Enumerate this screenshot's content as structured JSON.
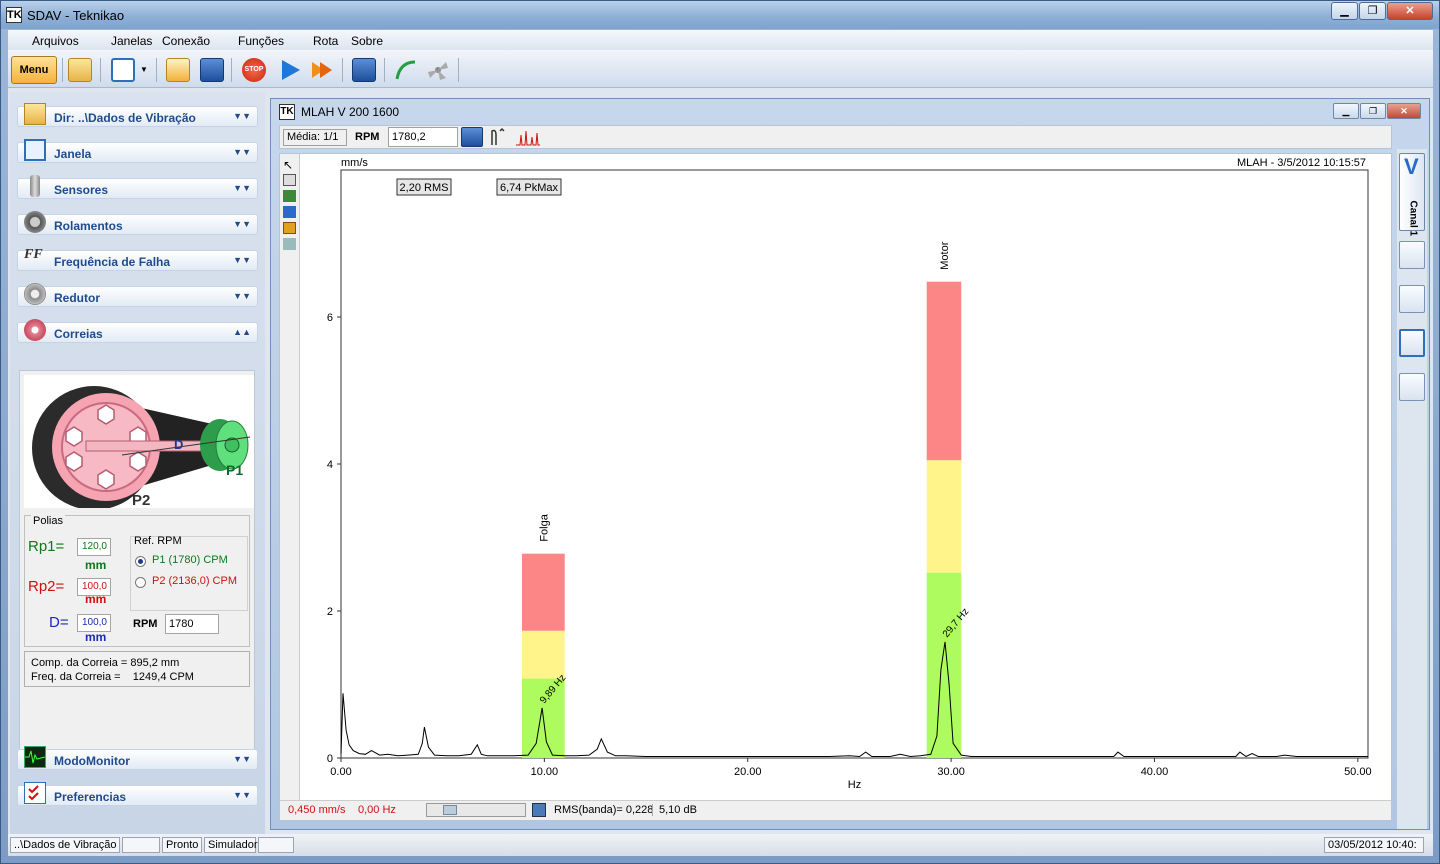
{
  "window": {
    "title": "SDAV - Teknikao",
    "app_icon": "TK"
  },
  "menu": [
    "Arquivos",
    "Janelas",
    "Conexão",
    "Funções",
    "Rota",
    "Sobre"
  ],
  "toolbar": {
    "menu_label": "Menu",
    "stop_label": "STOP"
  },
  "sidebar": {
    "items": [
      "Dir: ..\\Dados de Vibração",
      "Janela",
      "Sensores",
      "Rolamentos",
      "Frequência de Falha",
      "Redutor",
      "Correias"
    ],
    "bottom_items": [
      "ModoMonitor",
      "Preferencias"
    ]
  },
  "belt": {
    "image_labels": {
      "d": "D",
      "p1": "P1",
      "p2": "P2"
    },
    "polias_title": "Polias",
    "rp1_label": "Rp1=",
    "rp1_value": "120,0",
    "rp1_unit": "mm",
    "rp2_label": "Rp2=",
    "rp2_value": "100,0",
    "rp2_unit": "mm",
    "d_label": "D=",
    "d_value": "100,0",
    "d_unit": "mm",
    "ref_title": "Ref. RPM",
    "ref_p1": "P1 (1780) CPM",
    "ref_p2": "P2 (2136,0) CPM",
    "rpm_label": "RPM",
    "rpm_value": "1780",
    "comp": "Comp. da Correia = 895,2 mm",
    "freq": "Freq. da Correia =    1249,4 CPM"
  },
  "statusbar": {
    "path": "..\\Dados de Vibração",
    "state": "Pronto",
    "mode": "Simulador",
    "datetime": "03/05/2012 10:40:"
  },
  "child": {
    "title": "MLAH V 200 1600",
    "media": "Média: 1/1",
    "rpm_label": "RPM",
    "rpm_value": "1780,2"
  },
  "plot_status": {
    "amp": "0,450 mm/s",
    "freq": "0,00 Hz",
    "rms_band": "RMS(banda)= 0,228",
    "db": "5,10 dB"
  },
  "right_tab": "Canal 1",
  "chart_data": {
    "type": "line",
    "unit_label": "mm/s",
    "header_right": "MLAH - 3/5/2012 10:15:57",
    "xlabel": "Hz",
    "xlim": [
      0,
      50.5
    ],
    "ylim": [
      0,
      8
    ],
    "xticks": [
      "0.00",
      "10.00",
      "20.00",
      "30.00",
      "40.00",
      "50.00"
    ],
    "yticks": [
      "0",
      "2",
      "4",
      "6"
    ],
    "overall": {
      "rms": "2,20 RMS",
      "pkmax": "6,74 PkMax"
    },
    "alarm_bands": [
      {
        "name": "Folga",
        "x0": 8.9,
        "x1": 11.0,
        "green": 1.08,
        "yellow": 1.73,
        "red": 2.78
      },
      {
        "name": "Motor",
        "x0": 28.8,
        "x1": 30.5,
        "green": 2.52,
        "yellow": 4.05,
        "red": 6.48
      }
    ],
    "peak_labels": [
      {
        "text": "9,89 Hz",
        "x": 9.89,
        "y": 0.68
      },
      {
        "text": "29,7 Hz",
        "x": 29.7,
        "y": 1.58
      }
    ],
    "colors": {
      "green": "#adfb5e",
      "yellow": "#fef48a",
      "red": "#fc8585"
    },
    "spectrum": {
      "x": [
        0,
        0.1,
        0.25,
        0.4,
        0.6,
        0.9,
        1.2,
        1.5,
        1.9,
        2.3,
        2.8,
        3.3,
        3.8,
        4.0,
        4.1,
        4.3,
        4.6,
        5.2,
        5.8,
        6.4,
        6.7,
        6.9,
        7.2,
        7.8,
        8.5,
        9.2,
        9.6,
        9.89,
        10.1,
        10.4,
        11.0,
        11.6,
        12.2,
        12.6,
        12.8,
        13.1,
        13.5,
        14.0,
        15,
        16,
        17,
        18,
        19,
        20,
        21,
        22,
        23,
        24,
        25,
        25.5,
        25.8,
        26.1,
        27,
        27.5,
        28,
        28.5,
        29,
        29.3,
        29.5,
        29.7,
        29.9,
        30.1,
        30.5,
        31,
        32,
        33,
        34,
        35,
        36,
        37,
        38,
        38.2,
        38.5,
        39,
        40,
        41,
        42,
        43,
        44,
        44.2,
        44.5,
        44.8,
        45.1,
        45.5,
        46,
        46.4,
        47,
        48,
        49,
        50,
        50.5
      ],
      "y": [
        0.05,
        0.88,
        0.38,
        0.18,
        0.1,
        0.06,
        0.05,
        0.1,
        0.04,
        0.05,
        0.03,
        0.04,
        0.05,
        0.2,
        0.42,
        0.15,
        0.04,
        0.03,
        0.03,
        0.05,
        0.18,
        0.05,
        0.03,
        0.03,
        0.03,
        0.04,
        0.2,
        0.68,
        0.22,
        0.04,
        0.03,
        0.03,
        0.04,
        0.12,
        0.26,
        0.08,
        0.03,
        0.03,
        0.02,
        0.02,
        0.02,
        0.02,
        0.02,
        0.02,
        0.02,
        0.02,
        0.02,
        0.02,
        0.03,
        0.02,
        0.08,
        0.02,
        0.02,
        0.05,
        0.02,
        0.03,
        0.05,
        0.3,
        1.2,
        1.58,
        1.0,
        0.2,
        0.04,
        0.02,
        0.02,
        0.02,
        0.02,
        0.02,
        0.02,
        0.02,
        0.02,
        0.08,
        0.02,
        0.02,
        0.02,
        0.02,
        0.02,
        0.02,
        0.02,
        0.08,
        0.02,
        0.06,
        0.02,
        0.02,
        0.02,
        0.04,
        0.02,
        0.02,
        0.02,
        0.02,
        0.02
      ]
    }
  }
}
